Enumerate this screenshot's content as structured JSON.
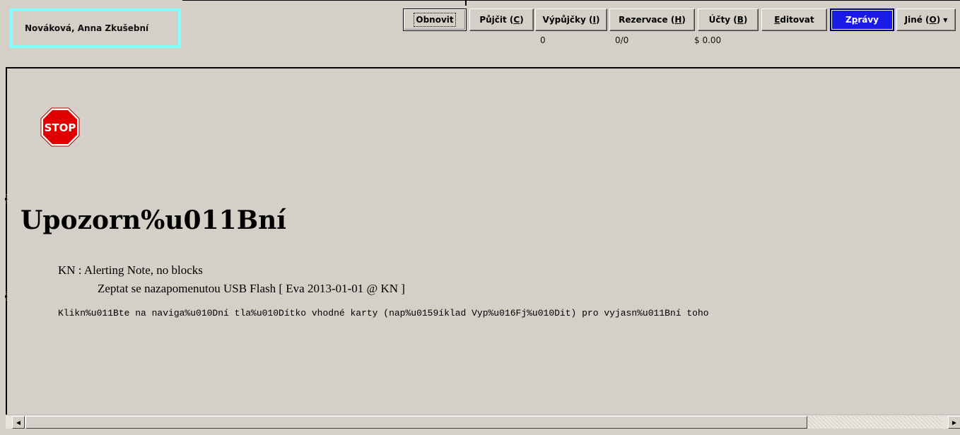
{
  "patron": {
    "name": "Nováková, Anna Zkušební"
  },
  "toolbar": {
    "refresh": "Obnovit",
    "checkout": {
      "pre": "Půjčit (",
      "key": "C",
      "post": ")"
    },
    "items_out": {
      "pre": "Výpůjčky (",
      "key": "I",
      "post": ")"
    },
    "holds": {
      "pre": "Rezervace (",
      "key": "H",
      "post": ")"
    },
    "bills": {
      "pre": "Účty (",
      "key": "B",
      "post": ")"
    },
    "edit": {
      "key": "E",
      "post": "ditovat"
    },
    "messages": {
      "pre": "Z",
      "key": "p",
      "post": "rávy"
    },
    "other": {
      "pre": "Jiné (",
      "key": "O",
      "post": ")"
    }
  },
  "counts": {
    "items_out": "0",
    "holds": "0/0",
    "bills": "$ 0.00"
  },
  "alert": {
    "icon": "stop-sign-icon",
    "icon_text": "STOP",
    "heading": "Upozorn%u011Bní",
    "note_title": "KN : Alerting Note, no blocks",
    "note_detail": "Zeptat se nazapomenutou USB Flash [ Eva 2013-01-01 @ KN ]",
    "instruction": "Klikn%u011Bte na naviga%u010Dní tla%u010Dítko vhodné karty (nap%u0159íklad Vyp%u016Fj%u010Dit) pro vyjasn%u011Bní toho"
  },
  "colors": {
    "patron_border": "#7fffff",
    "active_button": "#1a1ae6",
    "stop_red": "#e00000"
  }
}
